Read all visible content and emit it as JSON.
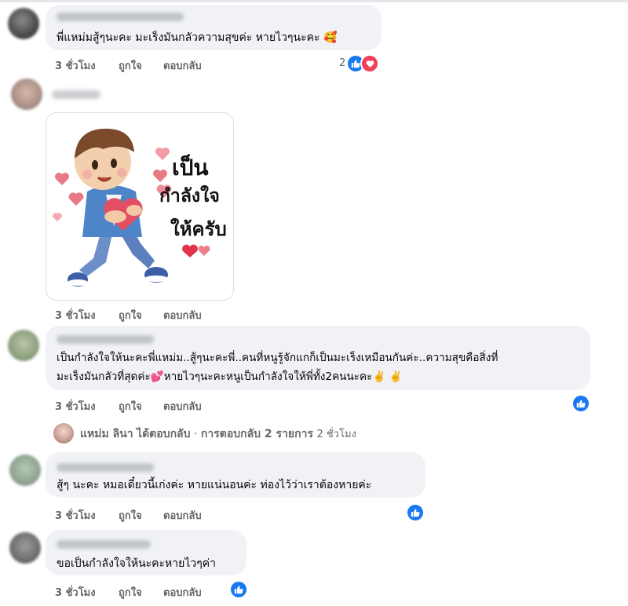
{
  "comments": [
    {
      "text": "พี่แหม่มสู้ๆนะคะ มะเร็งมันกลัวความสุขค่ะ หายไวๆนะคะ 🥰",
      "time": "3 ชั่วโมง",
      "like": "ถูกใจ",
      "reply": "ตอบกลับ",
      "reaction_count": "2"
    },
    {
      "time": "3 ชั่วโมง",
      "like": "ถูกใจ",
      "reply": "ตอบกลับ",
      "sticker": {
        "line1": "เป็น",
        "line2": "กำลังใจ",
        "line3": "ให้ครับ"
      }
    },
    {
      "line1": "เป็นกำลังใจให้นะคะพี่แหม่ม..สู้ๆนะคะพี่..คนที่หนูรู้จักแกก็เป็นมะเร็งเหมือนกันค่ะ..ความสุขคือสิ่งที่",
      "line2": "มะเร็งมันกลัวที่สุดค่ะ💕หายไวๆนะคะหนูเป็นกำลังใจให้พี่ทั้ง2คนนะคะ✌️ ✌️",
      "time": "3 ชั่วโมง",
      "like": "ถูกใจ",
      "reply": "ตอบกลับ"
    },
    {
      "text": "สู้ๆ นะคะ หมอเดี๋ยวนี้เก่งค่ะ หายแน่นอนค่ะ ท่องไว้ว่าเราต้องหายค่ะ",
      "time": "3 ชั่วโมง",
      "like": "ถูกใจ",
      "reply": "ตอบกลับ"
    },
    {
      "text": "ขอเป็นกำลังใจให้นะคะหายไวๆค่า",
      "time": "3 ชั่วโมง",
      "like": "ถูกใจ",
      "reply": "ตอบกลับ"
    }
  ],
  "reply_summary": {
    "name": "แหม่ม ลินา",
    "action": "ได้ตอบกลับ",
    "separator": "·",
    "count": "การตอบกลับ 2 รายการ",
    "time": "2 ชั่วโมง"
  },
  "colors": {
    "like_blue": "#1877f2",
    "love_red": "#f33e58",
    "bubble": "#f0f2f5",
    "meta_gray": "#65676b"
  }
}
